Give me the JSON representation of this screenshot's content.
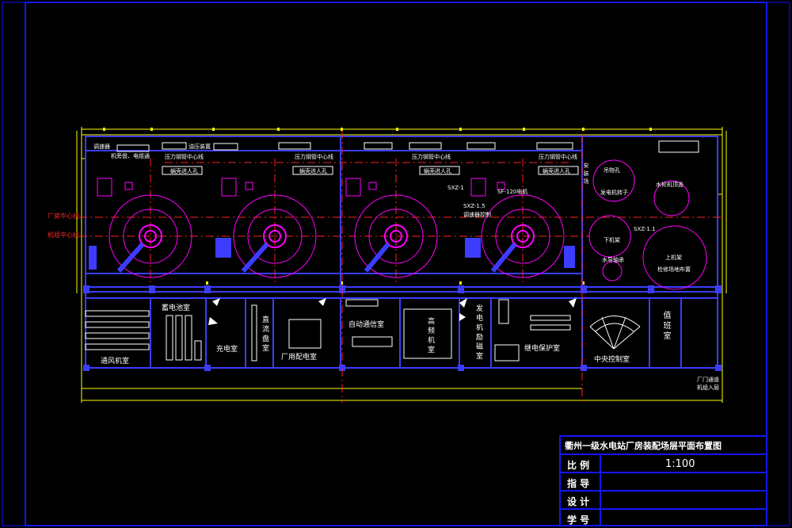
{
  "colors": {
    "background": "#000000",
    "frame": "#1414ff",
    "dim": "#ffff00",
    "axis": "#ff2020",
    "equipment": "#ff00ff",
    "wall": "#3c3cff",
    "text": "#ffffff"
  },
  "axis_labels": {
    "plant_center": "厂房中心线",
    "unit_center": "机组中心线"
  },
  "rooms": {
    "ventilation": "通风机室",
    "battery": "蓄电池室",
    "dc_screen": "直流盘室",
    "plant_power": "厂用配电室",
    "charging": "充电室",
    "auto_comm": "自动通信室",
    "high_freq": "高频机室",
    "gen_excitation": "发电机励磁室",
    "relay_protection": "继电保护室",
    "central_control": "中央控制室",
    "duty": "值班室",
    "entrance": "厂门通道\n机组入层"
  },
  "equipment_labels": {
    "speed_gov": "调速器",
    "oil_press": "油压装置",
    "pressure_pipe": "压力钢管中心线",
    "pipe_a": "机旁盘、电缆通",
    "pipe_b": "油压装置",
    "turbine_pit": "蜗壳进人孔",
    "unit_model": "SF-120电机",
    "hydro_model": "SXZ-1.5",
    "hydro_sub": "调速器控制",
    "box_tag": "SXZ-1",
    "rect_tag": "SXZ-1.1",
    "storage_area": "安装场",
    "gen_rotor": "发电机转子",
    "water_pit": "水轮机顶盖",
    "lower_frame": "下机架",
    "water_guide": "水导轴承",
    "upper_frame": "上机架",
    "pit_area": "检修场地布置",
    "crane": "吊物孔"
  },
  "title_block": {
    "title": "衢州一级水电站厂房装配场层平面布置图",
    "scale_label": "比 例",
    "scale_value": "1:100",
    "guide_label": "指 导",
    "design_label": "设 计",
    "student_label": "学 号"
  }
}
